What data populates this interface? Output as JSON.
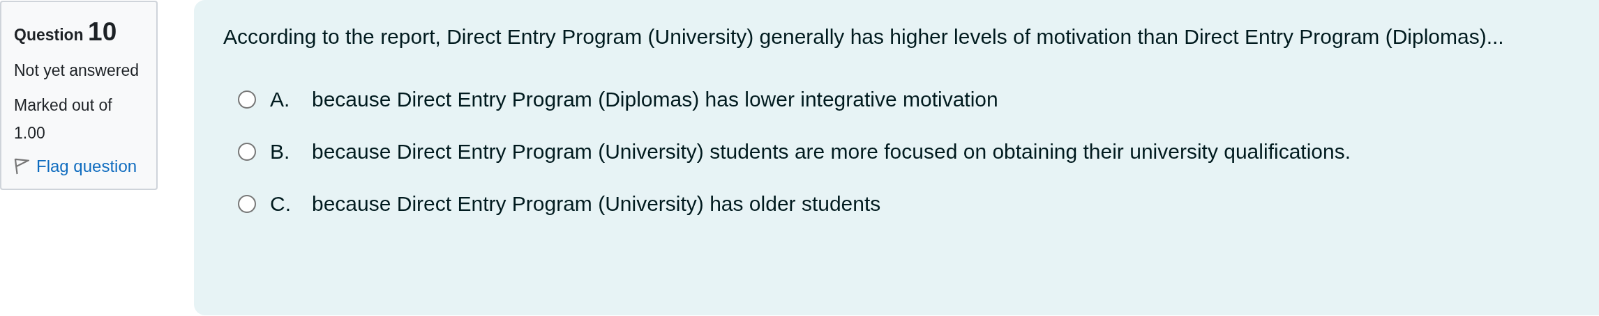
{
  "info": {
    "label": "Question",
    "number": "10",
    "state": "Not yet answered",
    "marked": "Marked out of 1.00",
    "flag": {
      "label": "Flag question",
      "flagged": false
    }
  },
  "question": {
    "text": "According to the report, Direct Entry Program (University) generally has higher levels of motivation than Direct Entry Program (Diplomas)...",
    "options": [
      {
        "letter": "A.",
        "text": "because Direct Entry Program (Diplomas) has lower integrative motivation",
        "selected": false
      },
      {
        "letter": "B.",
        "text": "because Direct Entry Program (University) students are more focused on obtaining their university qualifications.",
        "selected": false
      },
      {
        "letter": "C.",
        "text": "because Direct Entry Program (University) has older students",
        "selected": false
      }
    ]
  }
}
